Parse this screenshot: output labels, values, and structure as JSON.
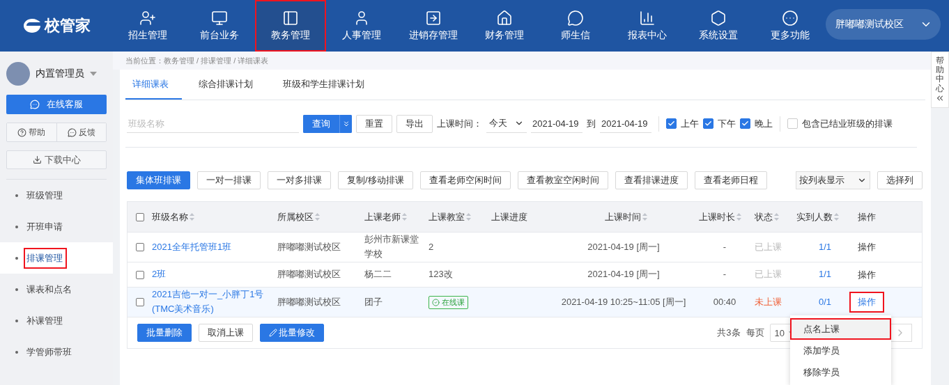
{
  "app": {
    "logo": "校管家"
  },
  "nav": [
    {
      "label": "招生管理",
      "selected": false,
      "highlighted": false
    },
    {
      "label": "前台业务",
      "selected": false,
      "highlighted": false
    },
    {
      "label": "教务管理",
      "selected": true,
      "highlighted": true
    },
    {
      "label": "人事管理",
      "selected": false,
      "highlighted": false
    },
    {
      "label": "进销存管理",
      "selected": false,
      "highlighted": false
    },
    {
      "label": "财务管理",
      "selected": false,
      "highlighted": false
    },
    {
      "label": "师生信",
      "selected": false,
      "highlighted": false
    },
    {
      "label": "报表中心",
      "selected": false,
      "highlighted": false
    },
    {
      "label": "系统设置",
      "selected": false,
      "highlighted": false
    },
    {
      "label": "更多功能",
      "selected": false,
      "highlighted": false
    }
  ],
  "campus_select": {
    "value": "胖嘟嘟测试校区"
  },
  "user": {
    "name": "内置管理员"
  },
  "service_button": "在线客服",
  "help_button": "帮助",
  "feedback_button": "反馈",
  "download_button": "下载中心",
  "sidebar": {
    "items": [
      {
        "label": "班级管理",
        "selected": false,
        "highlighted": false
      },
      {
        "label": "开班申请",
        "selected": false,
        "highlighted": false
      },
      {
        "label": "排课管理",
        "selected": true,
        "highlighted": true
      },
      {
        "label": "课表和点名",
        "selected": false,
        "highlighted": false
      },
      {
        "label": "补课管理",
        "selected": false,
        "highlighted": false
      },
      {
        "label": "学管师带班",
        "selected": false,
        "highlighted": false
      }
    ]
  },
  "breadcrumb": "当前位置：教务管理 / 排课管理 / 详细课表",
  "tabs": [
    {
      "label": "详细课表",
      "selected": true
    },
    {
      "label": "综合排课计划",
      "selected": false
    },
    {
      "label": "班级和学生排课计划",
      "selected": false
    }
  ],
  "filters": {
    "placeholder": "班级名称",
    "query": "查询",
    "reset": "重置",
    "export": "导出",
    "time_label": "上课时间：",
    "range": "今天",
    "from": "2021-04-19",
    "to_label": "到",
    "to": "2021-04-19",
    "periods": [
      {
        "label": "上午",
        "checked": true
      },
      {
        "label": "下午",
        "checked": true
      },
      {
        "label": "晚上",
        "checked": true
      }
    ],
    "include_finished": {
      "label": "包含已结业班级的排课",
      "checked": false
    }
  },
  "actions": [
    {
      "label": "集体班排课",
      "kind": "primary"
    },
    {
      "label": "一对一排课",
      "kind": "default"
    },
    {
      "label": "一对多排课",
      "kind": "default"
    },
    {
      "label": "复制/移动排课",
      "kind": "default"
    },
    {
      "label": "查看老师空闲时间",
      "kind": "default"
    },
    {
      "label": "查看教室空闲时间",
      "kind": "default"
    },
    {
      "label": "查看排课进度",
      "kind": "default"
    },
    {
      "label": "查看老师日程",
      "kind": "default"
    }
  ],
  "view_select": "按列表显示",
  "choose_columns": "选择列",
  "table": {
    "all_selected": false,
    "columns": [
      {
        "label": "班级名称",
        "sortable": true
      },
      {
        "label": "所属校区",
        "sortable": true
      },
      {
        "label": "上课老师",
        "sortable": true
      },
      {
        "label": "上课教室",
        "sortable": true
      },
      {
        "label": "上课进度",
        "sortable": false
      },
      {
        "label": "上课时间",
        "sortable": true
      },
      {
        "label": "上课时长",
        "sortable": true
      },
      {
        "label": "状态",
        "sortable": true
      },
      {
        "label": "实到人数",
        "sortable": true
      },
      {
        "label": "操作",
        "sortable": false
      }
    ],
    "rows": [
      {
        "selected": false,
        "hovered": false,
        "name": "2021全年托管班1班",
        "campus": "胖嘟嘟测试校区",
        "teacher": "彭州市新课堂学校",
        "room": {
          "text": "2",
          "online": false
        },
        "time": "2021-04-19 [周一]",
        "duration": "-",
        "status": {
          "text": "已上课",
          "done": true
        },
        "attendance": "1/1",
        "action": "操作",
        "action_active": false,
        "highlighted": false
      },
      {
        "selected": false,
        "hovered": false,
        "name": "2班",
        "campus": "胖嘟嘟测试校区",
        "teacher": "杨二二",
        "room": {
          "text": "123改",
          "online": false
        },
        "time": "2021-04-19 [周一]",
        "duration": "-",
        "status": {
          "text": "已上课",
          "done": true
        },
        "attendance": "1/1",
        "action": "操作",
        "action_active": false,
        "highlighted": false
      },
      {
        "selected": false,
        "hovered": true,
        "name": "2021吉他一对一_小胖丁1号(TMC美术音乐)",
        "campus": "胖嘟嘟测试校区",
        "teacher": "团子",
        "room": {
          "text": "在线课",
          "online": true
        },
        "time": "2021-04-19 10:25~11:05 [周一]",
        "duration": "00:40",
        "status": {
          "text": "未上课",
          "done": false
        },
        "attendance": "0/1",
        "action": "操作",
        "action_active": true,
        "highlighted": true
      }
    ]
  },
  "bulk_buttons": [
    {
      "label": "批量删除",
      "kind": "primary"
    },
    {
      "label": "取消上课",
      "kind": "default"
    },
    {
      "label": "批量修改",
      "kind": "edit"
    }
  ],
  "pagination": {
    "total": "共3条",
    "per_page_label": "每页",
    "per_page": "10"
  },
  "row_menu": {
    "items": [
      {
        "label": "点名上课",
        "hovered": true,
        "highlighted": true
      },
      {
        "label": "添加学员",
        "hovered": false,
        "highlighted": false
      },
      {
        "label": "移除学员",
        "hovered": false,
        "highlighted": false
      }
    ]
  },
  "help_center": {
    "label": "帮助中心"
  }
}
